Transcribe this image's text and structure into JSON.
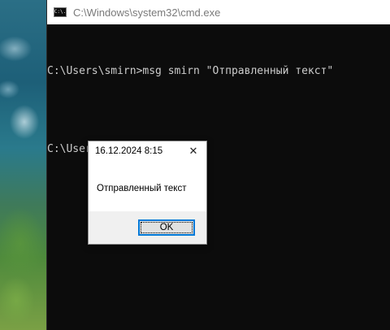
{
  "window": {
    "title": "C:\\Windows\\system32\\cmd.exe",
    "icon": "console-app-icon",
    "icon_text": "C:\\."
  },
  "console": {
    "lines": [
      "C:\\Users\\smirn>msg smirn \"Отправленный текст\"",
      "C:\\Users\\smirn>"
    ]
  },
  "message_box": {
    "title": "16.12.2024 8:15",
    "message": "Отправленный текст",
    "ok_label": "OK",
    "close_glyph": "✕"
  },
  "colors": {
    "console_bg": "#0c0c0c",
    "console_text": "#cccccc",
    "focus_accent": "#0078d7"
  }
}
